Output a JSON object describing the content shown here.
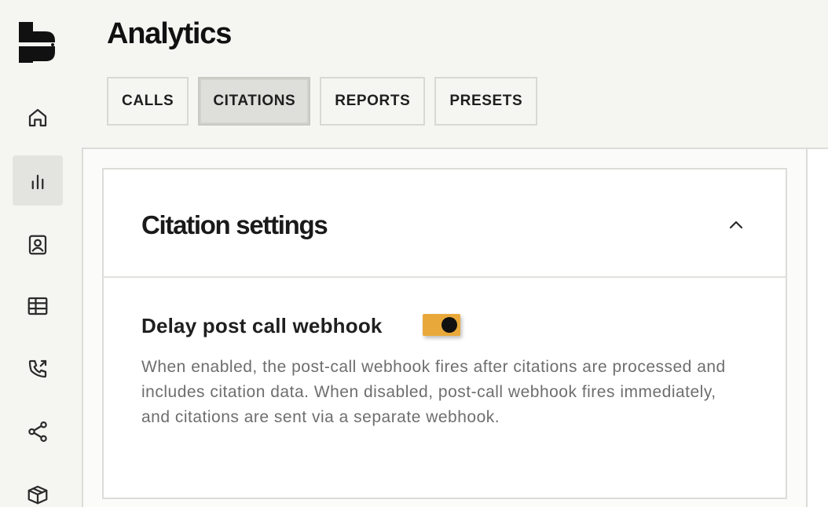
{
  "page": {
    "title": "Analytics"
  },
  "tabs": [
    {
      "label": "CALLS",
      "active": false
    },
    {
      "label": "CITATIONS",
      "active": true
    },
    {
      "label": "REPORTS",
      "active": false
    },
    {
      "label": "PRESETS",
      "active": false
    }
  ],
  "sidebar": {
    "items": [
      {
        "icon": "home-icon",
        "active": false
      },
      {
        "icon": "bar-chart-icon",
        "active": true
      },
      {
        "icon": "contact-card-icon",
        "active": false
      },
      {
        "icon": "table-icon",
        "active": false
      },
      {
        "icon": "phone-outgoing-icon",
        "active": false
      },
      {
        "icon": "share-icon",
        "active": false
      },
      {
        "icon": "box-icon",
        "active": false
      }
    ]
  },
  "card": {
    "title": "Citation settings",
    "collapse_icon": "chevron-up-icon",
    "setting": {
      "label": "Delay post call webhook",
      "enabled": true,
      "description": "When enabled, the post-call webhook fires after citations are processed and includes citation data. When disabled, post-call webhook fires immediately, and citations are sent via a separate webhook."
    }
  },
  "colors": {
    "toggle_on": "#e9a93a",
    "background": "#f5f5f2",
    "active_tab": "#dededa"
  }
}
